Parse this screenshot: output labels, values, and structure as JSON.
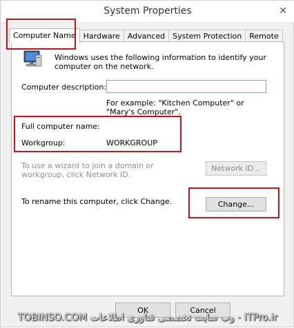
{
  "window": {
    "title": "System Properties"
  },
  "tabs": [
    {
      "label": "Computer Name",
      "active": true
    },
    {
      "label": "Hardware",
      "active": false
    },
    {
      "label": "Advanced",
      "active": false
    },
    {
      "label": "System Protection",
      "active": false
    },
    {
      "label": "Remote",
      "active": false
    }
  ],
  "panel": {
    "intro": "Windows uses the following information to identify your computer on the network.",
    "description_label": "Computer description:",
    "description_value": "",
    "description_hint": "For example: \"Kitchen Computer\" or \"Mary's Computer\".",
    "full_name_label": "Full computer name:",
    "full_name_value": "",
    "workgroup_label": "Workgroup:",
    "workgroup_value": "WORKGROUP",
    "wizard_text": "To use a wizard to join a domain or workgroup, click Network ID.",
    "network_id_button": "Network ID...",
    "rename_text": "To rename this computer, click Change.",
    "change_button": "Change..."
  },
  "footer": {
    "ok_button": "OK",
    "cancel_button": "Cancel"
  },
  "watermark": {
    "text": "TOBINSO.COM وب سایت تخصصی فناوری اطلاعات - ITPro.ir"
  },
  "colors": {
    "highlight": "#d01010",
    "input_border": "#7aa7d8"
  },
  "icons": {
    "computer": "computer-icon",
    "close": "close-icon"
  }
}
